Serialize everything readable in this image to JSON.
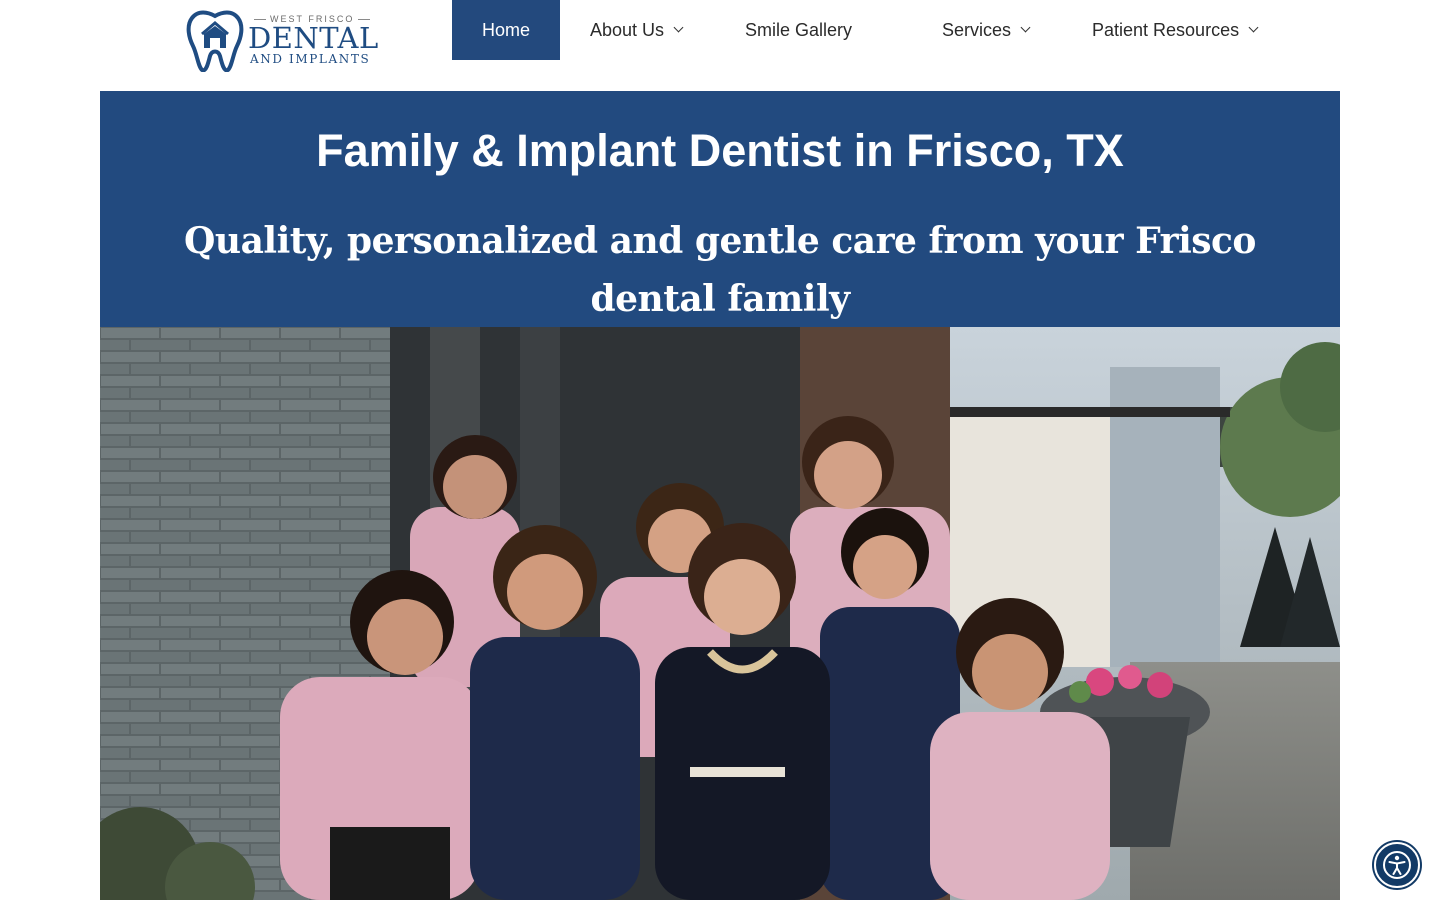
{
  "logo": {
    "small_text": "WEST FRISCO",
    "main_text": "DENTAL",
    "sub_text": "AND IMPLANTS",
    "icon": "tooth-logo-icon"
  },
  "nav": {
    "items": [
      {
        "label": "Home",
        "active": true,
        "has_dropdown": false
      },
      {
        "label": "About Us",
        "active": false,
        "has_dropdown": true
      },
      {
        "label": "Smile Gallery",
        "active": false,
        "has_dropdown": false
      },
      {
        "label": "Services",
        "active": false,
        "has_dropdown": true
      },
      {
        "label": "Patient Resources",
        "active": false,
        "has_dropdown": true
      }
    ]
  },
  "hero": {
    "title": "Family & Implant Dentist in Frisco, TX",
    "subtitle": "Quality, personalized and gentle care from your Frisco dental family",
    "image": "team-photo"
  },
  "accessibility": {
    "icon": "accessibility-icon"
  },
  "colors": {
    "brand_blue": "#224a7f",
    "nav_active": "#23497d",
    "logo_blue": "#1f4c82",
    "a11y_button": "#123a66"
  }
}
